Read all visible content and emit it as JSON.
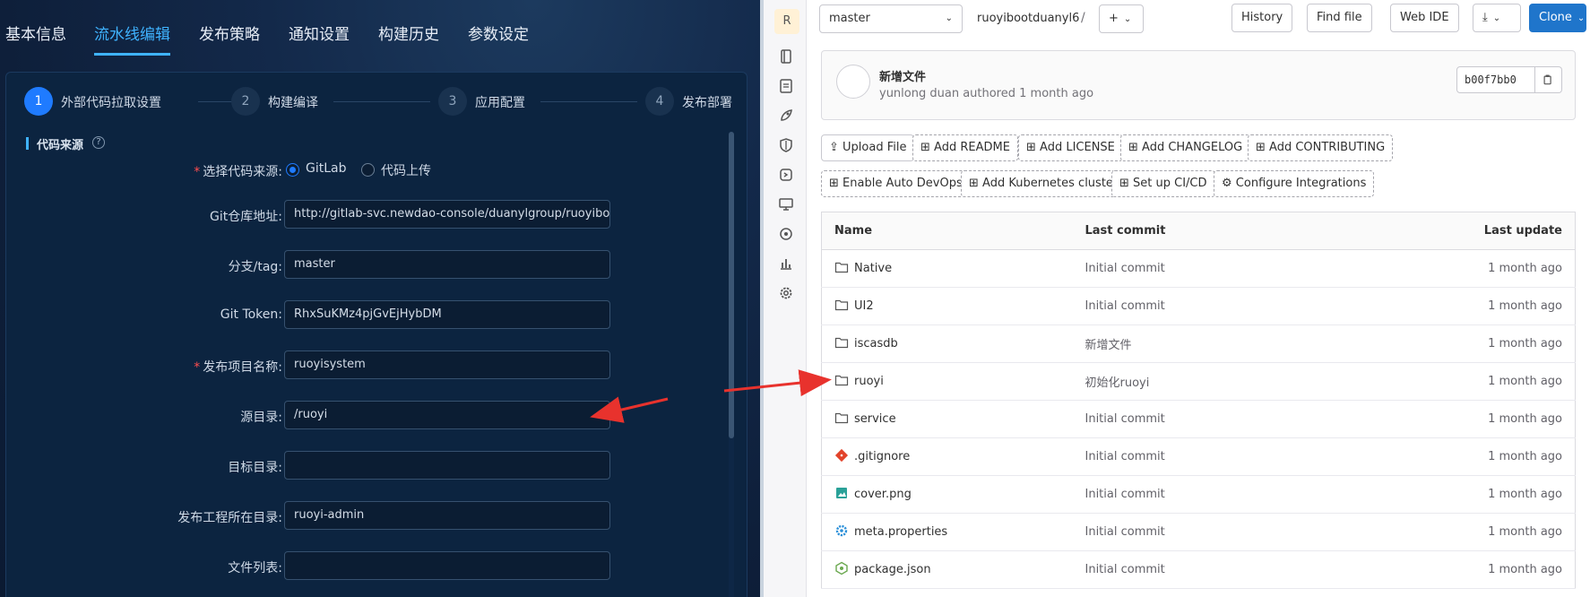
{
  "left": {
    "tabs": [
      {
        "label": "基本信息"
      },
      {
        "label": "流水线编辑"
      },
      {
        "label": "发布策略"
      },
      {
        "label": "通知设置"
      },
      {
        "label": "构建历史"
      },
      {
        "label": "参数设定"
      }
    ],
    "active_tab": "流水线编辑",
    "steps": [
      {
        "num": "1",
        "label": "外部代码拉取设置"
      },
      {
        "num": "2",
        "label": "构建编译"
      },
      {
        "num": "3",
        "label": "应用配置"
      },
      {
        "num": "4",
        "label": "发布部署"
      }
    ],
    "section_title": "代码来源",
    "required_mark": "*",
    "source": {
      "label": "选择代码来源:",
      "options": [
        "GitLab",
        "代码上传"
      ],
      "selected": "GitLab"
    },
    "fields": [
      {
        "label": "Git仓库地址:",
        "value": "http://gitlab-svc.newdao-console/duanylgroup/ruoyiboo",
        "required": false
      },
      {
        "label": "分支/tag:",
        "value": "master",
        "required": false
      },
      {
        "label": "Git Token:",
        "value": "RhxSuKMz4pjGvEjHybDM",
        "required": false
      },
      {
        "label": "发布项目名称:",
        "value": "ruoyisystem",
        "required": true
      },
      {
        "label": "源目录:",
        "value": "/ruoyi",
        "required": false
      },
      {
        "label": "目标目录:",
        "value": "",
        "required": false
      },
      {
        "label": "发布工程所在目录:",
        "value": "ruoyi-admin",
        "required": false
      },
      {
        "label": "文件列表:",
        "value": "",
        "required": false
      }
    ]
  },
  "gitlab": {
    "project_initial": "R",
    "branch": "master",
    "breadcrumb": "ruoyibootduanyl6",
    "breadcrumb_sep": "/",
    "add_symbol": "+",
    "buttons": {
      "history": "History",
      "find_file": "Find file",
      "web_ide": "Web IDE",
      "clone": "Clone"
    },
    "last_commit": {
      "title": "新增文件",
      "meta": "yunlong duan authored 1 month ago",
      "sha": "b00f7bb0"
    },
    "actions_row1": [
      "Upload File",
      "Add README",
      "Add LICENSE",
      "Add CHANGELOG",
      "Add CONTRIBUTING"
    ],
    "actions_row2": [
      "Enable Auto DevOps",
      "Add Kubernetes cluster",
      "Set up CI/CD",
      "Configure Integrations"
    ],
    "table": {
      "headers": {
        "name": "Name",
        "commit": "Last commit",
        "update": "Last update"
      },
      "rows": [
        {
          "name": "Native",
          "icon": "folder-icon",
          "commit": "Initial commit",
          "update": "1 month ago"
        },
        {
          "name": "UI2",
          "icon": "folder-icon",
          "commit": "Initial commit",
          "update": "1 month ago"
        },
        {
          "name": "iscasdb",
          "icon": "folder-icon",
          "commit": "新增文件",
          "update": "1 month ago"
        },
        {
          "name": "ruoyi",
          "icon": "folder-icon",
          "commit": "初始化ruoyi",
          "update": "1 month ago"
        },
        {
          "name": "service",
          "icon": "folder-icon",
          "commit": "Initial commit",
          "update": "1 month ago"
        },
        {
          "name": ".gitignore",
          "icon": "git-icon",
          "commit": "Initial commit",
          "update": "1 month ago"
        },
        {
          "name": "cover.png",
          "icon": "image-icon",
          "commit": "Initial commit",
          "update": "1 month ago"
        },
        {
          "name": "meta.properties",
          "icon": "settings-file-icon",
          "commit": "Initial commit",
          "update": "1 month ago"
        },
        {
          "name": "package.json",
          "icon": "node-icon",
          "commit": "Initial commit",
          "update": "1 month ago"
        }
      ]
    }
  },
  "colors": {
    "annotation_arrow": "#e8322d",
    "accent_left": "#3fb3ff",
    "gitlab_blue": "#1f75cb"
  }
}
